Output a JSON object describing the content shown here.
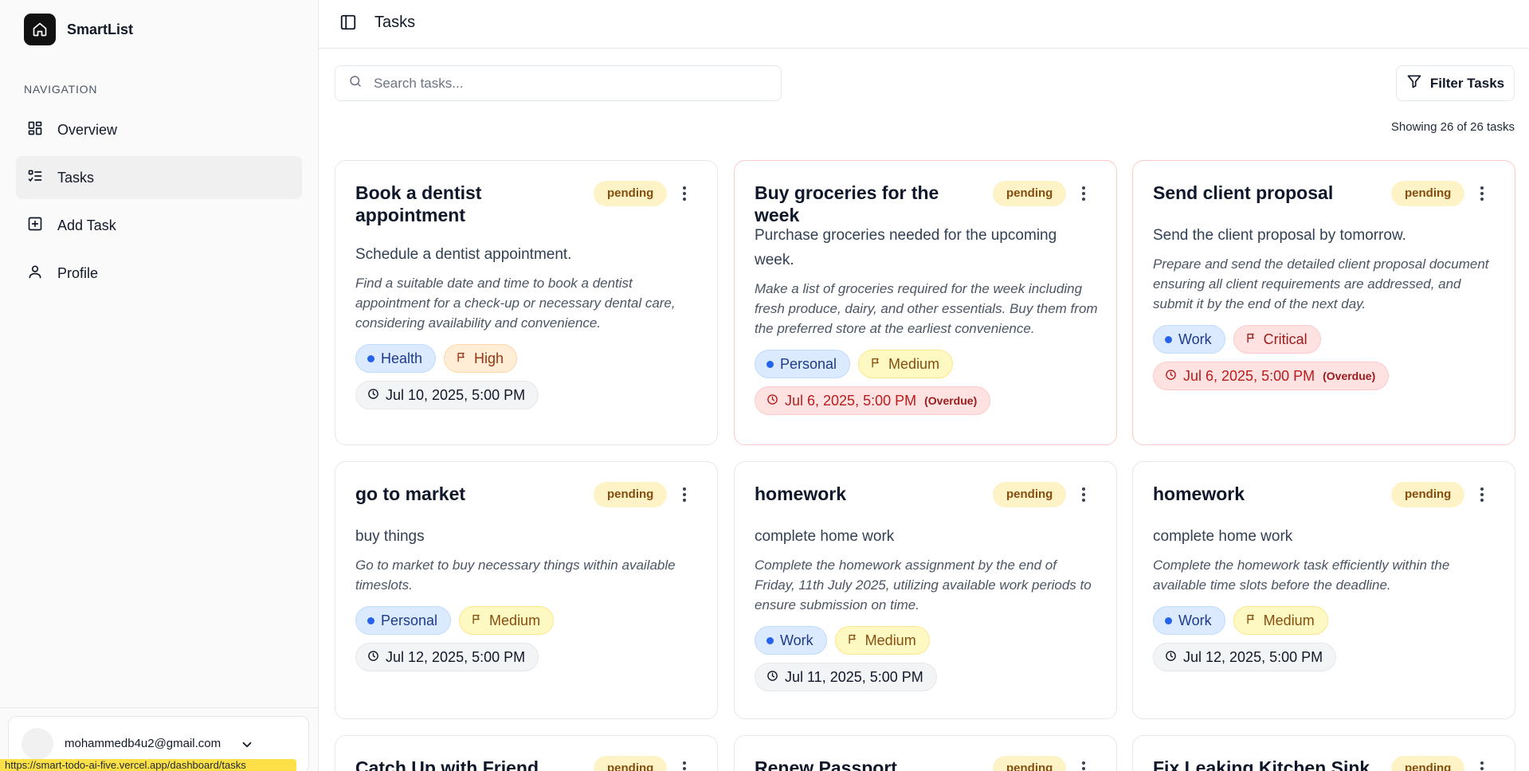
{
  "app": {
    "name": "SmartList"
  },
  "sidebar": {
    "heading": "NAVIGATION",
    "items": [
      {
        "label": "Overview",
        "icon": "overview-icon"
      },
      {
        "label": "Tasks",
        "icon": "tasks-icon",
        "active": true
      },
      {
        "label": "Add Task",
        "icon": "add-task-icon"
      },
      {
        "label": "Profile",
        "icon": "profile-icon"
      }
    ],
    "user": {
      "email": "mohammedb4u2@gmail.com"
    }
  },
  "header": {
    "title": "Tasks"
  },
  "search": {
    "placeholder": "Search tasks..."
  },
  "filter": {
    "label": "Filter Tasks"
  },
  "summary": {
    "showing": "Showing 26 of 26 tasks"
  },
  "status_bar": {
    "url": "https://smart-todo-ai-five.vercel.app/dashboard/tasks"
  },
  "colors": {
    "status_bg": "#fef3c7",
    "category": "#2563eb",
    "overdue": "#b91c1c"
  },
  "tasks": [
    {
      "title": "Book a dentist appointment",
      "status": "pending",
      "subtitle": "Schedule a dentist appointment.",
      "description": "Find a suitable date and time to book a dentist appointment for a check-up or necessary dental care, considering availability and convenience.",
      "category": "Health",
      "priority": "High",
      "due": "Jul 10, 2025, 5:00 PM",
      "overdue": ""
    },
    {
      "title": "Buy groceries for the week",
      "status": "pending",
      "subtitle": "Purchase groceries needed for the upcoming week.",
      "description": "Make a list of groceries required for the week including fresh produce, dairy, and other essentials. Buy them from the preferred store at the earliest convenience.",
      "category": "Personal",
      "priority": "Medium",
      "due": "Jul 6, 2025, 5:00 PM",
      "overdue": "(Overdue)"
    },
    {
      "title": "Send client proposal",
      "status": "pending",
      "subtitle": "Send the client proposal by tomorrow.",
      "description": "Prepare and send the detailed client proposal document ensuring all client requirements are addressed, and submit it by the end of the next day.",
      "category": "Work",
      "priority": "Critical",
      "due": "Jul 6, 2025, 5:00 PM",
      "overdue": "(Overdue)"
    },
    {
      "title": "go to market",
      "status": "pending",
      "subtitle": "buy things",
      "description": "Go to market to buy necessary things within available timeslots.",
      "category": "Personal",
      "priority": "Medium",
      "due": "Jul 12, 2025, 5:00 PM",
      "overdue": ""
    },
    {
      "title": "homework",
      "status": "pending",
      "subtitle": "complete home work",
      "description": "Complete the homework assignment by the end of Friday, 11th July 2025, utilizing available work periods to ensure submission on time.",
      "category": "Work",
      "priority": "Medium",
      "due": "Jul 11, 2025, 5:00 PM",
      "overdue": ""
    },
    {
      "title": "homework",
      "status": "pending",
      "subtitle": "complete home work",
      "description": "Complete the homework task efficiently within the available time slots before the deadline.",
      "category": "Work",
      "priority": "Medium",
      "due": "Jul 12, 2025, 5:00 PM",
      "overdue": ""
    },
    {
      "title": "Catch Up with Friend",
      "status": "pending"
    },
    {
      "title": "Renew Passport",
      "status": "pending"
    },
    {
      "title": "Fix Leaking Kitchen Sink",
      "status": "pending"
    }
  ]
}
